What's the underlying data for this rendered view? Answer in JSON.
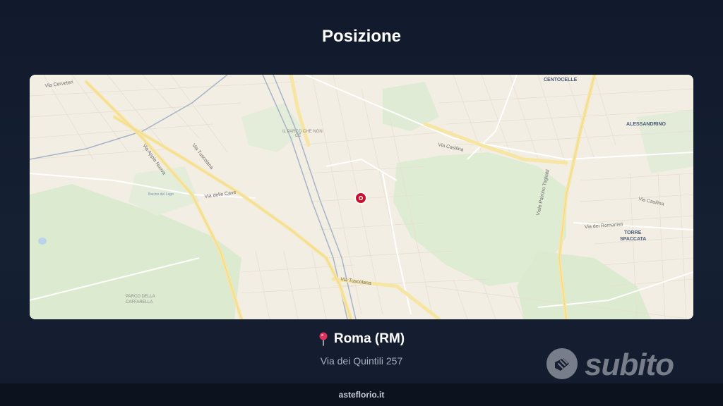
{
  "header": {
    "title": "Posizione"
  },
  "map": {
    "districts": [
      "CENTOCELLE",
      "ALESSANDRINO",
      "TORRE",
      "SPACCATA",
      "PARCO DELLA",
      "CAFFARELLA",
      "IL PARCO CHE NON",
      "CE"
    ],
    "roads": [
      "Via Cerveteri",
      "Via Appia Nuova",
      "Via Tuscolana",
      "Via delle Cave",
      "Via Casilina",
      "Viale Palmiro Togliatti",
      "Via dei Romanisti",
      "Via Anagnina",
      "Via del Quadraro",
      "Via Lemonia"
    ],
    "water_label": "Bacino del Lago"
  },
  "location": {
    "city": "Roma (RM)",
    "address": "Via dei Quintili 257"
  },
  "brand": {
    "name": "subito"
  },
  "footer": {
    "text": "asteflorio.it"
  }
}
